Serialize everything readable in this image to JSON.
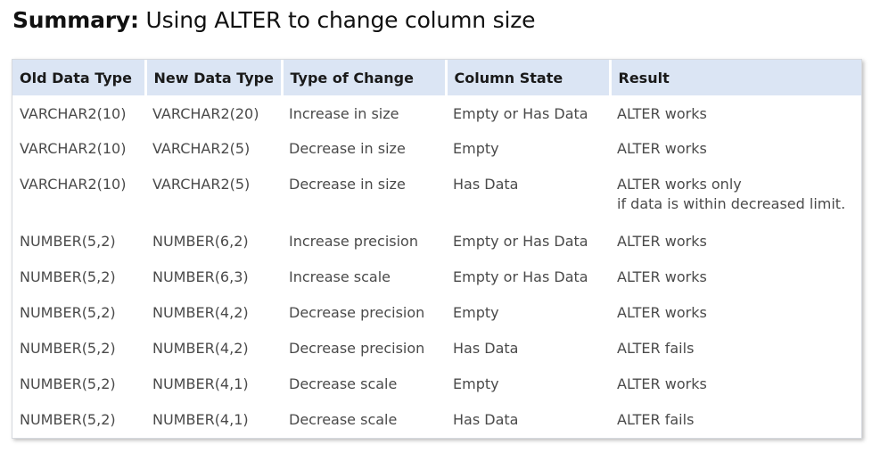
{
  "title": {
    "bold": "Summary:",
    "rest": " Using ALTER to change column size"
  },
  "table": {
    "headers": [
      "Old Data Type",
      "New Data Type",
      "Type of Change",
      "Column State",
      "Result"
    ],
    "rows": [
      {
        "old": "VARCHAR2(10)",
        "new": "VARCHAR2(20)",
        "change": "Increase in size",
        "state": "Empty or Has Data",
        "result": "ALTER works",
        "result2": ""
      },
      {
        "old": "VARCHAR2(10)",
        "new": "VARCHAR2(5)",
        "change": "Decrease in size",
        "state": "Empty",
        "result": "ALTER works",
        "result2": ""
      },
      {
        "old": "VARCHAR2(10)",
        "new": "VARCHAR2(5)",
        "change": "Decrease in size",
        "state": "Has Data",
        "result": "ALTER works only",
        "result2": "if data is within decreased limit."
      },
      {
        "old": "NUMBER(5,2)",
        "new": "NUMBER(6,2)",
        "change": "Increase precision",
        "state": "Empty or Has Data",
        "result": "ALTER works",
        "result2": ""
      },
      {
        "old": "NUMBER(5,2)",
        "new": "NUMBER(6,3)",
        "change": "Increase scale",
        "state": "Empty or Has Data",
        "result": "ALTER works",
        "result2": ""
      },
      {
        "old": "NUMBER(5,2)",
        "new": "NUMBER(4,2)",
        "change": "Decrease precision",
        "state": "Empty",
        "result": "ALTER works",
        "result2": ""
      },
      {
        "old": "NUMBER(5,2)",
        "new": "NUMBER(4,2)",
        "change": "Decrease precision",
        "state": "Has Data",
        "result": "ALTER fails",
        "result2": ""
      },
      {
        "old": "NUMBER(5,2)",
        "new": "NUMBER(4,1)",
        "change": "Decrease scale",
        "state": "Empty",
        "result": "ALTER works",
        "result2": ""
      },
      {
        "old": "NUMBER(5,2)",
        "new": "NUMBER(4,1)",
        "change": "Decrease scale",
        "state": "Has Data",
        "result": "ALTER fails",
        "result2": ""
      }
    ]
  }
}
